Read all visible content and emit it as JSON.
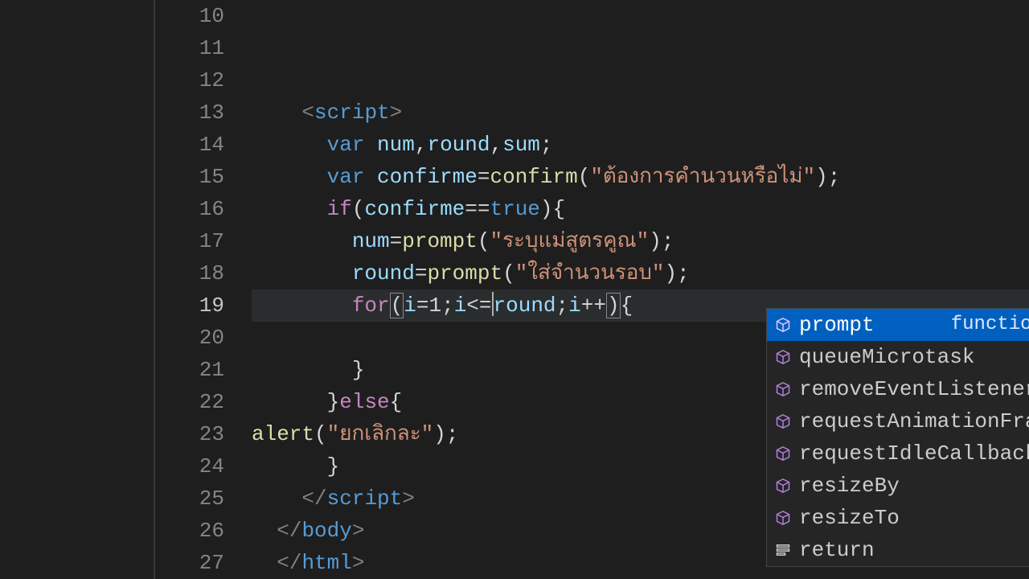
{
  "gutter": {
    "start": 10,
    "end": 27,
    "active": 19
  },
  "code": {
    "l10": "",
    "l11": "",
    "l12": "",
    "l13": {
      "open": "<",
      "tag": "script",
      "close": ">"
    },
    "l14": {
      "kw": "var",
      "v1": "num",
      "v2": "round",
      "v3": "sum"
    },
    "l15": {
      "kw": "var",
      "v": "confirme",
      "fn": "confirm",
      "str": "\"ต้องการคำนวนหรือไม่\""
    },
    "l16": {
      "kw": "if",
      "v": "confirme",
      "bool": "true"
    },
    "l17": {
      "v": "num",
      "fn": "prompt",
      "str": "\"ระบุแม่สูตรคูณ\""
    },
    "l18": {
      "v": "round",
      "fn": "prompt",
      "str": "\"ใส่จำนวนรอบ\""
    },
    "l19": {
      "kw": "for",
      "a": "i",
      "b": "1",
      "c": "i",
      "d": "round",
      "e": "i"
    },
    "l20": "",
    "l21": "}",
    "l22": {
      "close": "}",
      "kw": "else",
      "open": "{"
    },
    "l23": {
      "fn": "alert",
      "str": "\"ยกเลิกละ\""
    },
    "l24": "}",
    "l25": {
      "open": "</",
      "tag": "script",
      "close": ">"
    },
    "l26": {
      "open": "</",
      "tag": "body",
      "close": ">"
    },
    "l27": {
      "open": "</",
      "tag": "html",
      "close": ">"
    }
  },
  "suggest": {
    "detail": "function prompt(message?: st",
    "items": [
      {
        "label": "prompt",
        "kind": "method",
        "selected": true
      },
      {
        "label": "queueMicrotask",
        "kind": "method"
      },
      {
        "label": "removeEventListener",
        "kind": "method"
      },
      {
        "label": "requestAnimationFrame",
        "kind": "method"
      },
      {
        "label": "requestIdleCallback",
        "kind": "method"
      },
      {
        "label": "resizeBy",
        "kind": "method"
      },
      {
        "label": "resizeTo",
        "kind": "method"
      },
      {
        "label": "return",
        "kind": "keyword"
      }
    ]
  }
}
